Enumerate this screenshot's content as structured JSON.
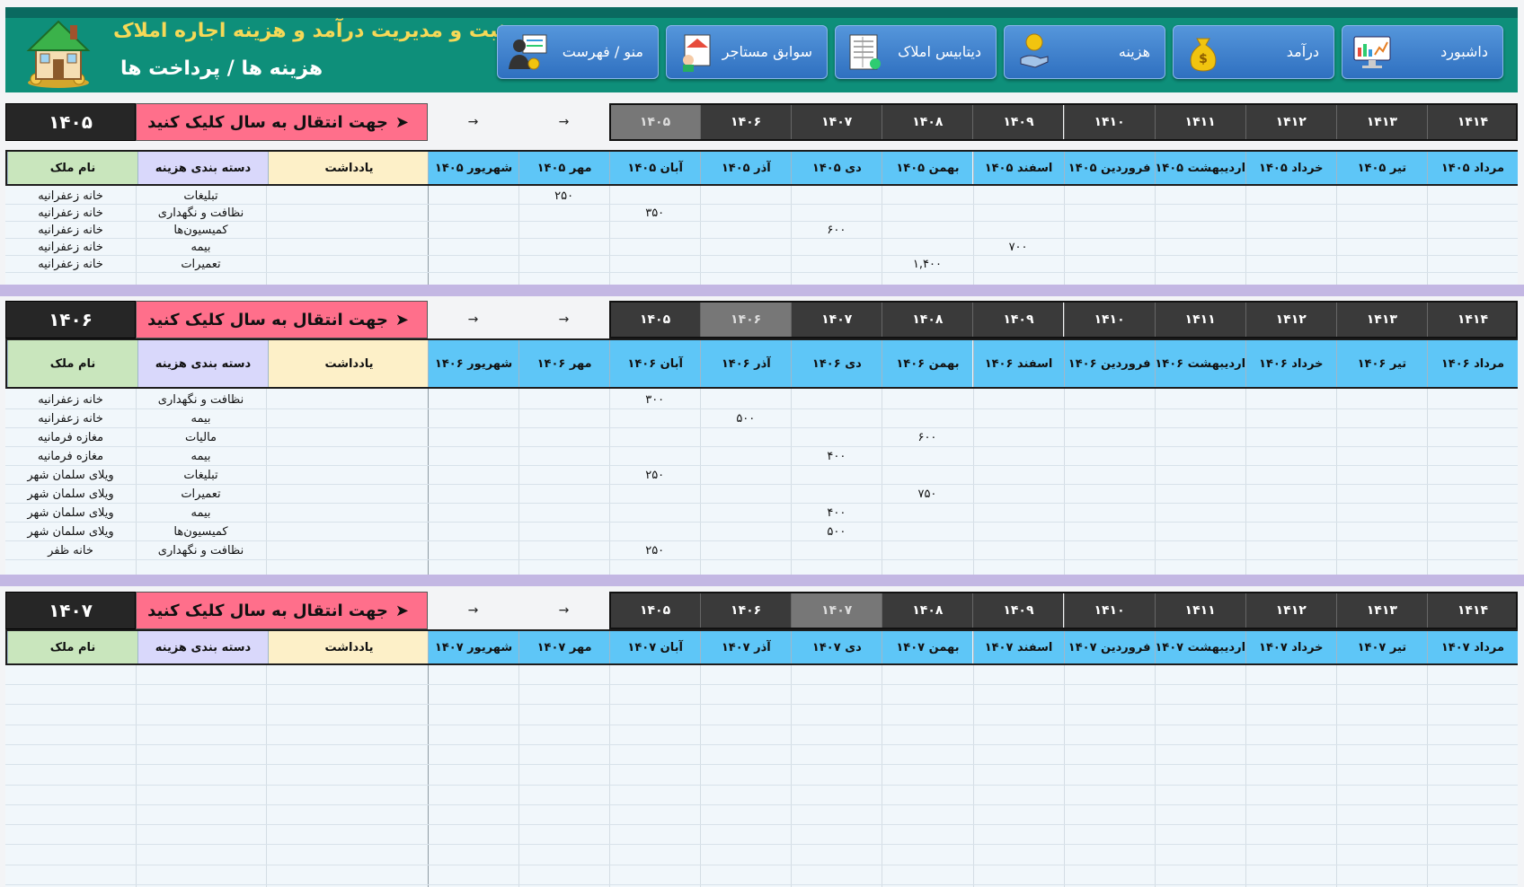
{
  "header": {
    "title": "ثبت و مدیریت درآمد و هزینه اجاره املاک",
    "subtitle": "هزینه ها / پرداخت ها",
    "nav": [
      {
        "label": "داشبورد",
        "icon": "dashboard-monitor-icon"
      },
      {
        "label": "درآمد",
        "icon": "money-bag-icon"
      },
      {
        "label": "هزینه",
        "icon": "coin-hand-icon"
      },
      {
        "label": "دیتابیس املاک",
        "icon": "database-sheet-icon"
      },
      {
        "label": "سوابق مستاجر",
        "icon": "tenant-file-icon"
      },
      {
        "label": "منو / فهرست",
        "icon": "menu-person-icon"
      }
    ]
  },
  "common": {
    "go_label": "جهت انتقال به سال کلیک کنید",
    "go_arrow": "➤",
    "arrow_symbol": "→",
    "col_name": "نام ملک",
    "col_category": "دسته بندی هزینه",
    "col_note": "یادداشت",
    "year_tabs": [
      "۱۴۰۵",
      "۱۴۰۶",
      "۱۴۰۷",
      "۱۴۰۸",
      "۱۴۰۹",
      "۱۴۱۰",
      "۱۴۱۱",
      "۱۴۱۲",
      "۱۴۱۳",
      "۱۴۱۴"
    ],
    "month_names": [
      "شهریور",
      "مهر",
      "آبان",
      "آذر",
      "دی",
      "بهمن",
      "اسفند",
      "فروردین",
      "اردیبهشت",
      "خرداد",
      "تیر",
      "مرداد"
    ]
  },
  "sections": [
    {
      "year": "۱۴۰۵",
      "active_tab": 0,
      "months": [
        "شهریور ۱۴۰۵",
        "مهر ۱۴۰۵",
        "آبان ۱۴۰۵",
        "آذر ۱۴۰۵",
        "دی ۱۴۰۵",
        "بهمن ۱۴۰۵",
        "اسفند ۱۴۰۵",
        "فروردین ۱۴۰۵",
        "اردیبهشت ۱۴۰۵",
        "خرداد ۱۴۰۵",
        "تیر ۱۴۰۵",
        "مرداد ۱۴۰۵"
      ],
      "rows": [
        {
          "property": "خانه زعفرانیه",
          "category": "تبلیغات",
          "note": "",
          "month_index": 1,
          "amount": "۲۵۰"
        },
        {
          "property": "خانه زعفرانیه",
          "category": "نظافت و نگهداری",
          "note": "",
          "month_index": 2,
          "amount": "۳۵۰"
        },
        {
          "property": "خانه زعفرانیه",
          "category": "کمیسیون‌ها",
          "note": "",
          "month_index": 4,
          "amount": "۶۰۰"
        },
        {
          "property": "خانه زعفرانیه",
          "category": "بیمه",
          "note": "",
          "month_index": 6,
          "amount": "۷۰۰"
        },
        {
          "property": "خانه زعفرانیه",
          "category": "تعمیرات",
          "note": "",
          "month_index": 5,
          "amount": "۱,۴۰۰"
        }
      ]
    },
    {
      "year": "۱۴۰۶",
      "active_tab": 1,
      "months": [
        "شهریور ۱۴۰۶",
        "مهر ۱۴۰۶",
        "آبان ۱۴۰۶",
        "آذر ۱۴۰۶",
        "دی ۱۴۰۶",
        "بهمن ۱۴۰۶",
        "اسفند ۱۴۰۶",
        "فروردین ۱۴۰۶",
        "اردیبهشت ۱۴۰۶",
        "خرداد ۱۴۰۶",
        "تیر ۱۴۰۶",
        "مرداد ۱۴۰۶"
      ],
      "rows": [
        {
          "property": "خانه زعفرانیه",
          "category": "نظافت و نگهداری",
          "note": "",
          "month_index": 2,
          "amount": "۳۰۰"
        },
        {
          "property": "خانه زعفرانیه",
          "category": "بیمه",
          "note": "",
          "month_index": 3,
          "amount": "۵۰۰"
        },
        {
          "property": "مغازه فرمانیه",
          "category": "مالیات",
          "note": "",
          "month_index": 5,
          "amount": "۶۰۰"
        },
        {
          "property": "مغازه فرمانیه",
          "category": "بیمه",
          "note": "",
          "month_index": 4,
          "amount": "۴۰۰"
        },
        {
          "property": "ویلای سلمان شهر",
          "category": "تبلیغات",
          "note": "",
          "month_index": 2,
          "amount": "۲۵۰"
        },
        {
          "property": "ویلای سلمان شهر",
          "category": "تعمیرات",
          "note": "",
          "month_index": 5,
          "amount": "۷۵۰"
        },
        {
          "property": "ویلای سلمان شهر",
          "category": "بیمه",
          "note": "",
          "month_index": 4,
          "amount": "۴۰۰"
        },
        {
          "property": "ویلای سلمان شهر",
          "category": "کمیسیون‌ها",
          "note": "",
          "month_index": 4,
          "amount": "۵۰۰"
        },
        {
          "property": "خانه ظفر",
          "category": "نظافت و نگهداری",
          "note": "",
          "month_index": 2,
          "amount": "۲۵۰"
        }
      ]
    },
    {
      "year": "۱۴۰۷",
      "active_tab": 2,
      "months": [
        "شهریور ۱۴۰۷",
        "مهر ۱۴۰۷",
        "آبان ۱۴۰۷",
        "آذر ۱۴۰۷",
        "دی ۱۴۰۷",
        "بهمن ۱۴۰۷",
        "اسفند ۱۴۰۷",
        "فروردین ۱۴۰۷",
        "اردیبهشت ۱۴۰۷",
        "خرداد ۱۴۰۷",
        "تیر ۱۴۰۷",
        "مرداد ۱۴۰۷"
      ],
      "rows": []
    }
  ],
  "colors": {
    "header_green": "#0e8f7a",
    "title_yellow": "#f6d957",
    "nav_blue": "#3f80cf",
    "go_pink": "#ff6f8b",
    "month_header_blue": "#5ec6f7",
    "active_tab_gray": "#777777",
    "separator_lavender": "#c3b7e3"
  }
}
